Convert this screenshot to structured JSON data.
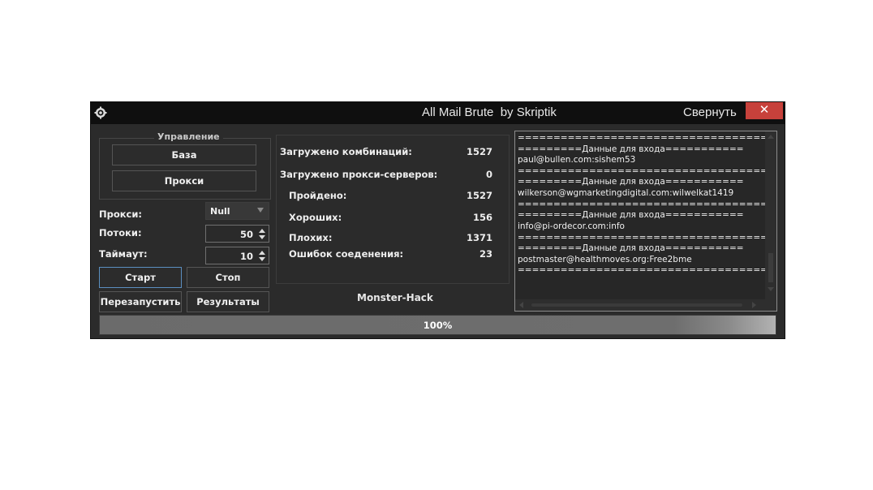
{
  "window": {
    "title": "All Mail Brute  by Skriptik",
    "minimize_label": "Свернуть",
    "close_label": "✕"
  },
  "control": {
    "group_label": "Управление",
    "base_button": "База",
    "proxy_button": "Прокси"
  },
  "settings": {
    "proxy_label": "Прокси:",
    "proxy_value": "Null",
    "threads_label": "Потоки:",
    "threads_value": "50",
    "timeout_label": "Таймаут:",
    "timeout_value": "10"
  },
  "actions": {
    "start": "Старт",
    "stop": "Стоп",
    "restart": "Перезапустить",
    "results": "Результаты"
  },
  "stats": {
    "combos_label": "Загружено комбинаций:",
    "combos_value": "1527",
    "proxies_label": "Загружено прокси-серверов:",
    "proxies_value": "0",
    "passed_label": "Пройдено:",
    "passed_value": "1527",
    "good_label": "Хороших:",
    "good_value": "156",
    "bad_label": "Плохих:",
    "bad_value": "1371",
    "errors_label": "Ошибок соеденения:",
    "errors_value": "23"
  },
  "brand": "Monster-Hack",
  "log": [
    "=====================================",
    "=========Данные для входа===========",
    "paul@bullen.com:sishem53",
    "=====================================",
    "=========Данные для входа===========",
    "wilkerson@wgmarketingdigital.com:wilwelkat1419",
    "=====================================",
    "=========Данные для входа===========",
    "info@pi-ordecor.com:info",
    "=====================================",
    "=========Данные для входа===========",
    "postmaster@healthmoves.org:Free2bme",
    "====================================="
  ],
  "progress": {
    "percent": 100,
    "label": "100%"
  },
  "colors": {
    "window_bg": "#2b2b2b",
    "titlebar_bg": "#0f0f0f",
    "close_bg": "#c7413b",
    "focus_border": "#5b8fc0"
  }
}
